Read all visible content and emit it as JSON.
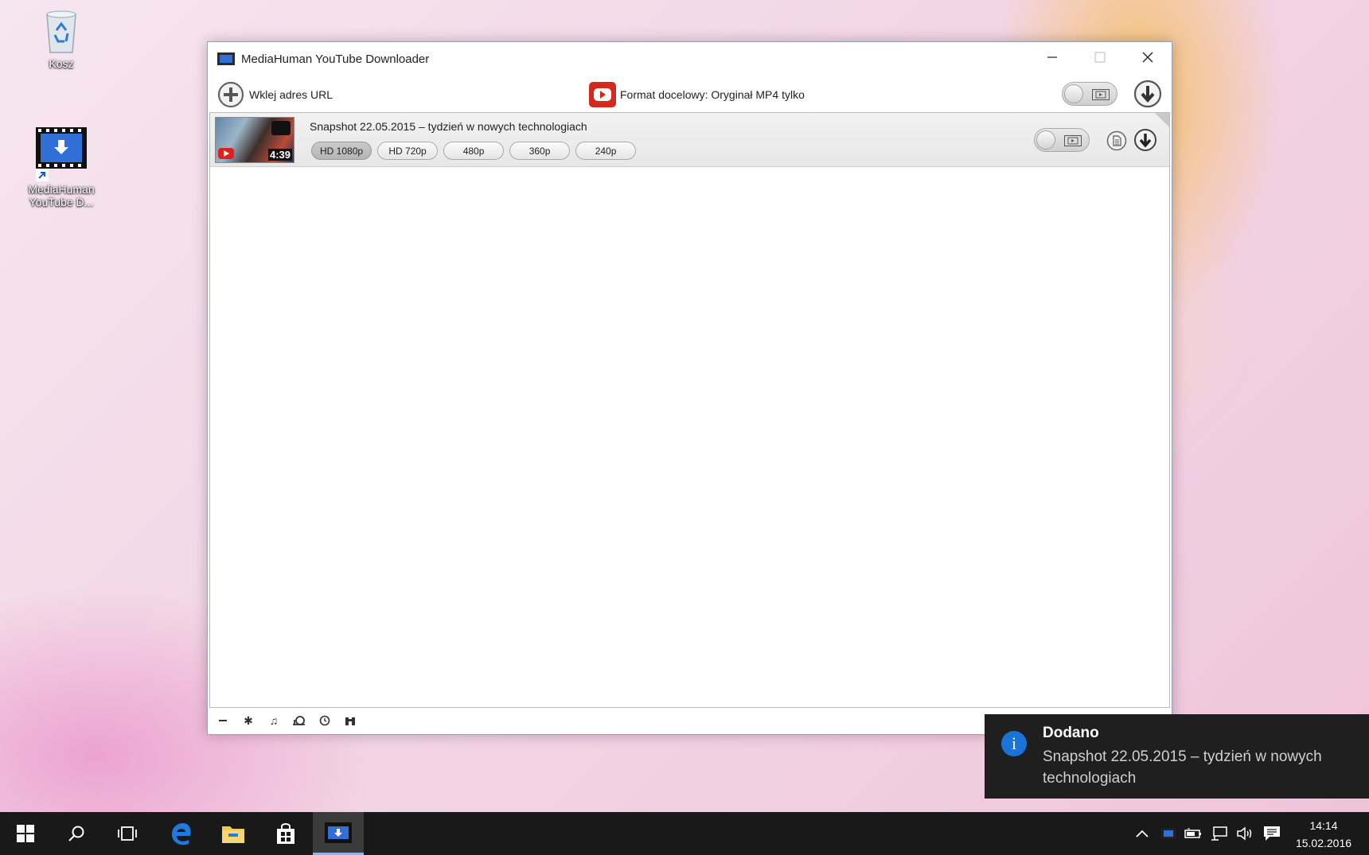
{
  "desktop": {
    "icons": [
      {
        "label": "Kosz"
      },
      {
        "label": "MediaHuman YouTube D..."
      }
    ]
  },
  "window": {
    "title": "MediaHuman YouTube Downloader",
    "toolbar": {
      "paste_label": "Wklej adres URL",
      "format_label": "Format docelowy: Oryginał MP4 tylko"
    },
    "items": [
      {
        "title": "Snapshot 22.05.2015 – tydzień w nowych technologiach",
        "duration": "4:39",
        "qualities": [
          "HD 1080p",
          "HD 720p",
          "480p",
          "360p",
          "240p"
        ],
        "selected_quality": "HD 1080p"
      }
    ]
  },
  "notification": {
    "title": "Dodano",
    "body": "Snapshot 22.05.2015 – tydzień w nowych technologiach"
  },
  "taskbar": {
    "clock_time": "14:14",
    "clock_date": "15.02.2016"
  },
  "colors": {
    "accent_blue": "#1a73d9",
    "youtube_red": "#e02020",
    "taskbar_bg": "#191919",
    "toast_bg": "#1f1f1f"
  }
}
